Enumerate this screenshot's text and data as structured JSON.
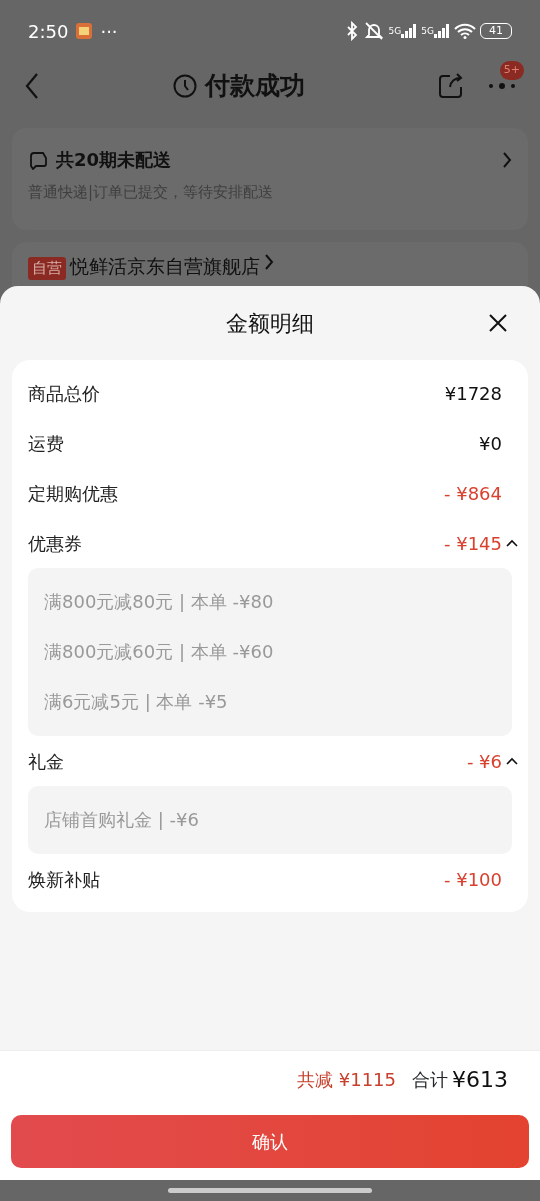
{
  "status_bar": {
    "time": "2:50",
    "more": "···",
    "network_1": "5G",
    "network_2": "5G",
    "battery": "41"
  },
  "header": {
    "title": "付款成功",
    "badge": "5+"
  },
  "delivery_card": {
    "title": "共20期未配送",
    "subtitle": "普通快递|订单已提交，等待安排配送"
  },
  "store": {
    "tag": "自营",
    "name": "悦鲜活京东自营旗舰店"
  },
  "sheet": {
    "title": "金额明细",
    "rows": [
      {
        "label": "商品总价",
        "amount": "¥1728",
        "kind": "plain"
      },
      {
        "label": "运费",
        "amount": "¥0",
        "kind": "plain"
      },
      {
        "label": "定期购优惠",
        "amount": "- ¥864",
        "kind": "discount"
      },
      {
        "label": "优惠券",
        "amount": "- ¥145",
        "kind": "discount",
        "expanded": true,
        "details": [
          "满800元减80元 | 本单 -¥80",
          "满800元减60元 | 本单 -¥60",
          "满6元减5元 | 本单 -¥5"
        ]
      },
      {
        "label": "礼金",
        "amount": "- ¥6",
        "kind": "discount",
        "expanded": true,
        "details": [
          "店铺首购礼金 | -¥6"
        ]
      },
      {
        "label": "焕新补贴",
        "amount": "- ¥100",
        "kind": "discount"
      }
    ]
  },
  "footer": {
    "saved_label": "共减",
    "saved_amount": "¥1115",
    "total_label": "合计",
    "total_amount": "¥613",
    "confirm": "确认"
  }
}
